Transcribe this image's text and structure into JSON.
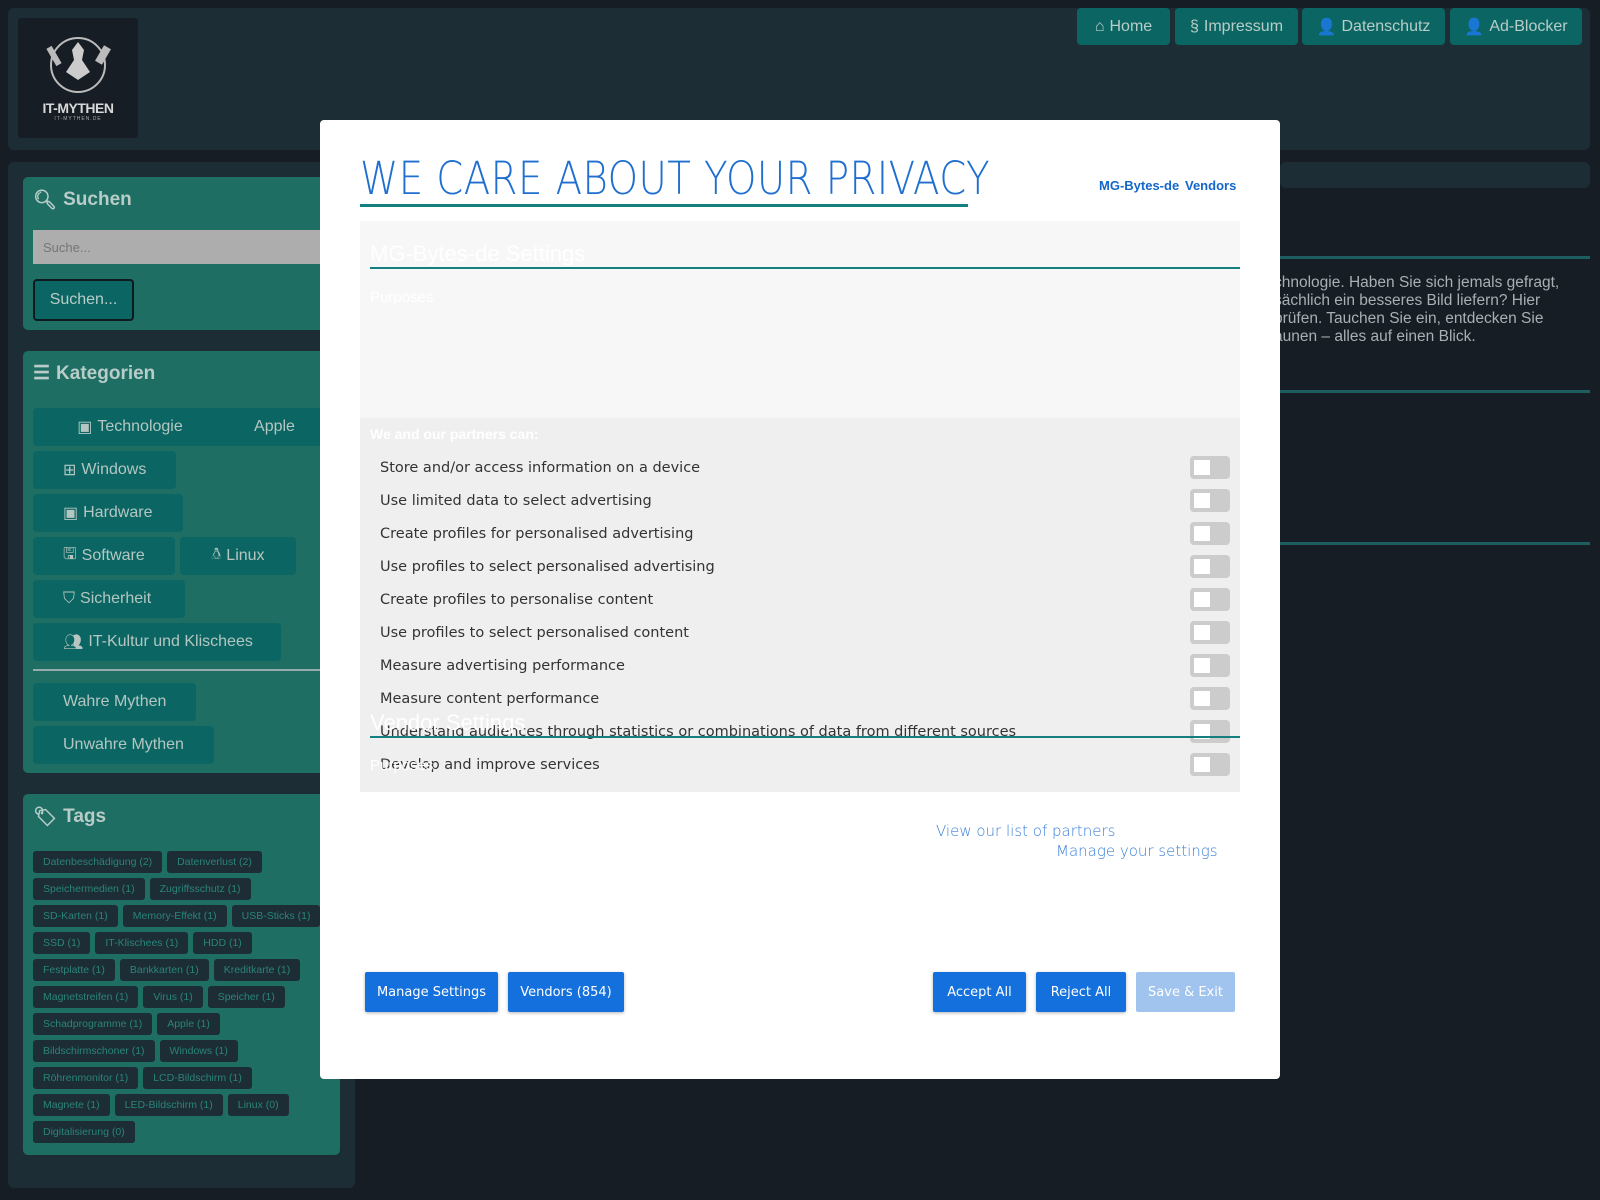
{
  "header": {
    "logo_title": "IT-MYTHEN",
    "logo_subtitle": "IT-MYTHEN.DE",
    "nav": [
      {
        "label": "Home",
        "icon": "home-icon"
      },
      {
        "label": "Impressum",
        "icon": "section-icon"
      },
      {
        "label": "Datenschutz",
        "icon": "user-shield-icon"
      },
      {
        "label": "Ad-Blocker",
        "icon": "user-shield-icon"
      }
    ]
  },
  "sidebar": {
    "search": {
      "title": "Suchen",
      "placeholder": "Suche...",
      "button": "Suchen..."
    },
    "categories": {
      "title": "Kategorien",
      "items": [
        "Technologie",
        "Apple",
        "Windows",
        "Hardware",
        "Software",
        "Linux",
        "Sicherheit",
        "IT-Kultur und Klischees"
      ],
      "myths": [
        "Wahre Mythen",
        "Unwahre Mythen"
      ]
    },
    "tags": {
      "title": "Tags",
      "items": [
        "Datenbeschädigung (2)",
        "Datenverlust (2)",
        "Speichermedien (1)",
        "Zugriffsschutz (1)",
        "SD-Karten (1)",
        "Memory-Effekt (1)",
        "USB-Sticks (1)",
        "SSD (1)",
        "IT-Klischees (1)",
        "HDD (1)",
        "Festplatte (1)",
        "Bankkarten (1)",
        "Kreditkarte (1)",
        "Magnetstreifen (1)",
        "Virus (1)",
        "Speicher (1)",
        "Schadprogramme (1)",
        "Apple (1)",
        "Bildschirmschoner (1)",
        "Windows (1)",
        "Röhrenmonitor (1)",
        "LCD-Bildschirm (1)",
        "Magnete (1)",
        "LED-Bildschirm (1)",
        "Linux (0)",
        "Digitalisierung (0)"
      ]
    }
  },
  "main": {
    "text_lines": [
      "chnologie. Haben Sie sich jemals gefragt,",
      "sächlich ein besseres Bild liefern? Hier",
      "prüfen. Tauchen Sie ein, entdecken Sie",
      "aunen – alles auf einen Blick."
    ]
  },
  "consent": {
    "title": "WE CARE ABOUT YOUR PRIVACY",
    "header_links": [
      "MG-Bytes-de",
      "Vendors"
    ],
    "publisher_section": "MG-Bytes-de Settings",
    "purposes_label": "Purposes",
    "partners_can": "We and our partners can:",
    "purposes": [
      {
        "label": "Store and/or access information on a device",
        "enabled": false
      },
      {
        "label": "Use limited data to select advertising",
        "enabled": false
      },
      {
        "label": "Create profiles for personalised advertising",
        "enabled": false
      },
      {
        "label": "Use profiles to select personalised advertising",
        "enabled": false
      },
      {
        "label": "Create profiles to personalise content",
        "enabled": false
      },
      {
        "label": "Use profiles to select personalised content",
        "enabled": false
      },
      {
        "label": "Measure advertising performance",
        "enabled": false
      },
      {
        "label": "Measure content performance",
        "enabled": false
      },
      {
        "label": "Understand audiences through statistics or combinations of data from different sources",
        "enabled": false
      },
      {
        "label": "Develop and improve services",
        "enabled": false
      }
    ],
    "vendor_section": "Vendor Settings",
    "vendor_purposes_label": "Purposes",
    "links": {
      "partners": "View our list of partners",
      "settings": "Manage your settings"
    },
    "buttons": {
      "manage": "Manage Settings",
      "vendors": "Vendors (854)",
      "accept": "Accept All",
      "reject": "Reject All",
      "save": "Save & Exit"
    },
    "colors": {
      "primary": "#1470dc",
      "accent": "#137f7f",
      "disabled": "#a0c4ee"
    }
  }
}
